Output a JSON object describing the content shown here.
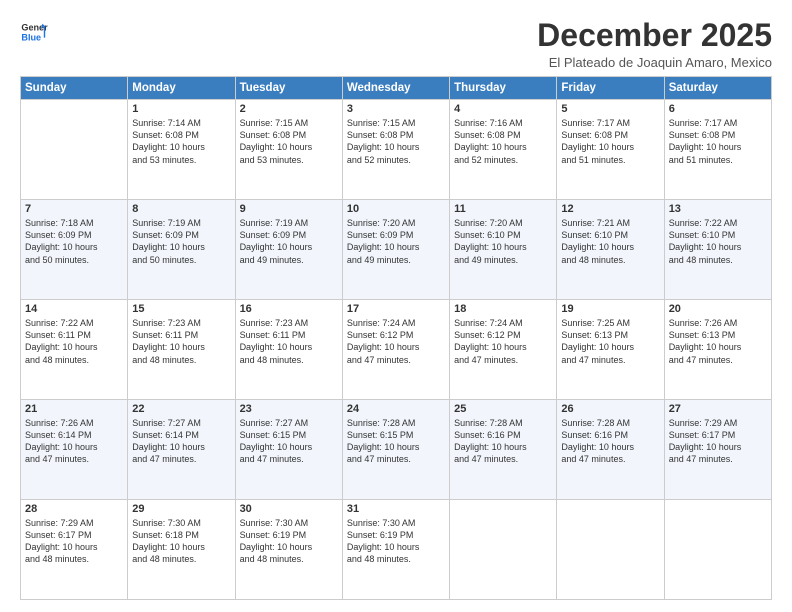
{
  "header": {
    "logo_line1": "General",
    "logo_line2": "Blue",
    "month": "December 2025",
    "location": "El Plateado de Joaquin Amaro, Mexico"
  },
  "days_of_week": [
    "Sunday",
    "Monday",
    "Tuesday",
    "Wednesday",
    "Thursday",
    "Friday",
    "Saturday"
  ],
  "weeks": [
    [
      {
        "num": "",
        "info": ""
      },
      {
        "num": "1",
        "info": "Sunrise: 7:14 AM\nSunset: 6:08 PM\nDaylight: 10 hours\nand 53 minutes."
      },
      {
        "num": "2",
        "info": "Sunrise: 7:15 AM\nSunset: 6:08 PM\nDaylight: 10 hours\nand 53 minutes."
      },
      {
        "num": "3",
        "info": "Sunrise: 7:15 AM\nSunset: 6:08 PM\nDaylight: 10 hours\nand 52 minutes."
      },
      {
        "num": "4",
        "info": "Sunrise: 7:16 AM\nSunset: 6:08 PM\nDaylight: 10 hours\nand 52 minutes."
      },
      {
        "num": "5",
        "info": "Sunrise: 7:17 AM\nSunset: 6:08 PM\nDaylight: 10 hours\nand 51 minutes."
      },
      {
        "num": "6",
        "info": "Sunrise: 7:17 AM\nSunset: 6:08 PM\nDaylight: 10 hours\nand 51 minutes."
      }
    ],
    [
      {
        "num": "7",
        "info": "Sunrise: 7:18 AM\nSunset: 6:09 PM\nDaylight: 10 hours\nand 50 minutes."
      },
      {
        "num": "8",
        "info": "Sunrise: 7:19 AM\nSunset: 6:09 PM\nDaylight: 10 hours\nand 50 minutes."
      },
      {
        "num": "9",
        "info": "Sunrise: 7:19 AM\nSunset: 6:09 PM\nDaylight: 10 hours\nand 49 minutes."
      },
      {
        "num": "10",
        "info": "Sunrise: 7:20 AM\nSunset: 6:09 PM\nDaylight: 10 hours\nand 49 minutes."
      },
      {
        "num": "11",
        "info": "Sunrise: 7:20 AM\nSunset: 6:10 PM\nDaylight: 10 hours\nand 49 minutes."
      },
      {
        "num": "12",
        "info": "Sunrise: 7:21 AM\nSunset: 6:10 PM\nDaylight: 10 hours\nand 48 minutes."
      },
      {
        "num": "13",
        "info": "Sunrise: 7:22 AM\nSunset: 6:10 PM\nDaylight: 10 hours\nand 48 minutes."
      }
    ],
    [
      {
        "num": "14",
        "info": "Sunrise: 7:22 AM\nSunset: 6:11 PM\nDaylight: 10 hours\nand 48 minutes."
      },
      {
        "num": "15",
        "info": "Sunrise: 7:23 AM\nSunset: 6:11 PM\nDaylight: 10 hours\nand 48 minutes."
      },
      {
        "num": "16",
        "info": "Sunrise: 7:23 AM\nSunset: 6:11 PM\nDaylight: 10 hours\nand 48 minutes."
      },
      {
        "num": "17",
        "info": "Sunrise: 7:24 AM\nSunset: 6:12 PM\nDaylight: 10 hours\nand 47 minutes."
      },
      {
        "num": "18",
        "info": "Sunrise: 7:24 AM\nSunset: 6:12 PM\nDaylight: 10 hours\nand 47 minutes."
      },
      {
        "num": "19",
        "info": "Sunrise: 7:25 AM\nSunset: 6:13 PM\nDaylight: 10 hours\nand 47 minutes."
      },
      {
        "num": "20",
        "info": "Sunrise: 7:26 AM\nSunset: 6:13 PM\nDaylight: 10 hours\nand 47 minutes."
      }
    ],
    [
      {
        "num": "21",
        "info": "Sunrise: 7:26 AM\nSunset: 6:14 PM\nDaylight: 10 hours\nand 47 minutes."
      },
      {
        "num": "22",
        "info": "Sunrise: 7:27 AM\nSunset: 6:14 PM\nDaylight: 10 hours\nand 47 minutes."
      },
      {
        "num": "23",
        "info": "Sunrise: 7:27 AM\nSunset: 6:15 PM\nDaylight: 10 hours\nand 47 minutes."
      },
      {
        "num": "24",
        "info": "Sunrise: 7:28 AM\nSunset: 6:15 PM\nDaylight: 10 hours\nand 47 minutes."
      },
      {
        "num": "25",
        "info": "Sunrise: 7:28 AM\nSunset: 6:16 PM\nDaylight: 10 hours\nand 47 minutes."
      },
      {
        "num": "26",
        "info": "Sunrise: 7:28 AM\nSunset: 6:16 PM\nDaylight: 10 hours\nand 47 minutes."
      },
      {
        "num": "27",
        "info": "Sunrise: 7:29 AM\nSunset: 6:17 PM\nDaylight: 10 hours\nand 47 minutes."
      }
    ],
    [
      {
        "num": "28",
        "info": "Sunrise: 7:29 AM\nSunset: 6:17 PM\nDaylight: 10 hours\nand 48 minutes."
      },
      {
        "num": "29",
        "info": "Sunrise: 7:30 AM\nSunset: 6:18 PM\nDaylight: 10 hours\nand 48 minutes."
      },
      {
        "num": "30",
        "info": "Sunrise: 7:30 AM\nSunset: 6:19 PM\nDaylight: 10 hours\nand 48 minutes."
      },
      {
        "num": "31",
        "info": "Sunrise: 7:30 AM\nSunset: 6:19 PM\nDaylight: 10 hours\nand 48 minutes."
      },
      {
        "num": "",
        "info": ""
      },
      {
        "num": "",
        "info": ""
      },
      {
        "num": "",
        "info": ""
      }
    ]
  ]
}
